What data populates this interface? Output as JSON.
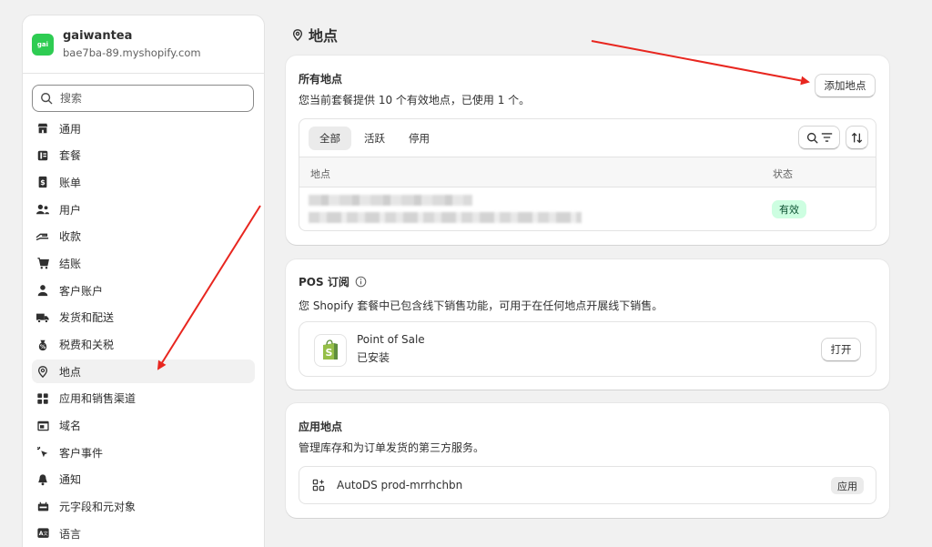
{
  "store": {
    "logo_text": "gai",
    "name": "gaiwantea",
    "domain": "bae7ba-89.myshopify.com"
  },
  "search": {
    "placeholder": "搜索"
  },
  "nav": [
    {
      "label": "通用",
      "icon": "store-icon"
    },
    {
      "label": "套餐",
      "icon": "plan-icon"
    },
    {
      "label": "账单",
      "icon": "billing-icon"
    },
    {
      "label": "用户",
      "icon": "users-icon"
    },
    {
      "label": "收款",
      "icon": "payments-icon"
    },
    {
      "label": "结账",
      "icon": "cart-icon"
    },
    {
      "label": "客户账户",
      "icon": "person-icon"
    },
    {
      "label": "发货和配送",
      "icon": "truck-icon"
    },
    {
      "label": "税费和关税",
      "icon": "tax-icon"
    },
    {
      "label": "地点",
      "icon": "location-icon"
    },
    {
      "label": "应用和销售渠道",
      "icon": "apps-icon"
    },
    {
      "label": "域名",
      "icon": "domain-icon"
    },
    {
      "label": "客户事件",
      "icon": "cursor-icon"
    },
    {
      "label": "通知",
      "icon": "bell-icon"
    },
    {
      "label": "元字段和元对象",
      "icon": "metafields-icon"
    },
    {
      "label": "语言",
      "icon": "language-icon"
    }
  ],
  "page": {
    "title": "地点"
  },
  "locations": {
    "title": "所有地点",
    "subtitle": "您当前套餐提供 10 个有效地点，已使用 1 个。",
    "add_button": "添加地点",
    "tabs": [
      "全部",
      "活跃",
      "停用"
    ],
    "columns": {
      "location": "地点",
      "status": "状态"
    },
    "rows": [
      {
        "status": "有效"
      }
    ]
  },
  "pos": {
    "title": "POS 订阅",
    "subtitle": "您 Shopify 套餐中已包含线下销售功能，可用于在任何地点开展线下销售。",
    "app_name": "Point of Sale",
    "app_status": "已安装",
    "open_button": "打开"
  },
  "app_locations": {
    "title": "应用地点",
    "subtitle": "管理库存和为订单发货的第三方服务。",
    "app_name": "AutoDS prod-mrrhchbn",
    "tag": "应用"
  },
  "colors": {
    "active_badge_bg": "#cdfee1",
    "active_badge_text": "#0c5132",
    "arrow": "#e8261f",
    "store_logo": "#2ecc52"
  }
}
